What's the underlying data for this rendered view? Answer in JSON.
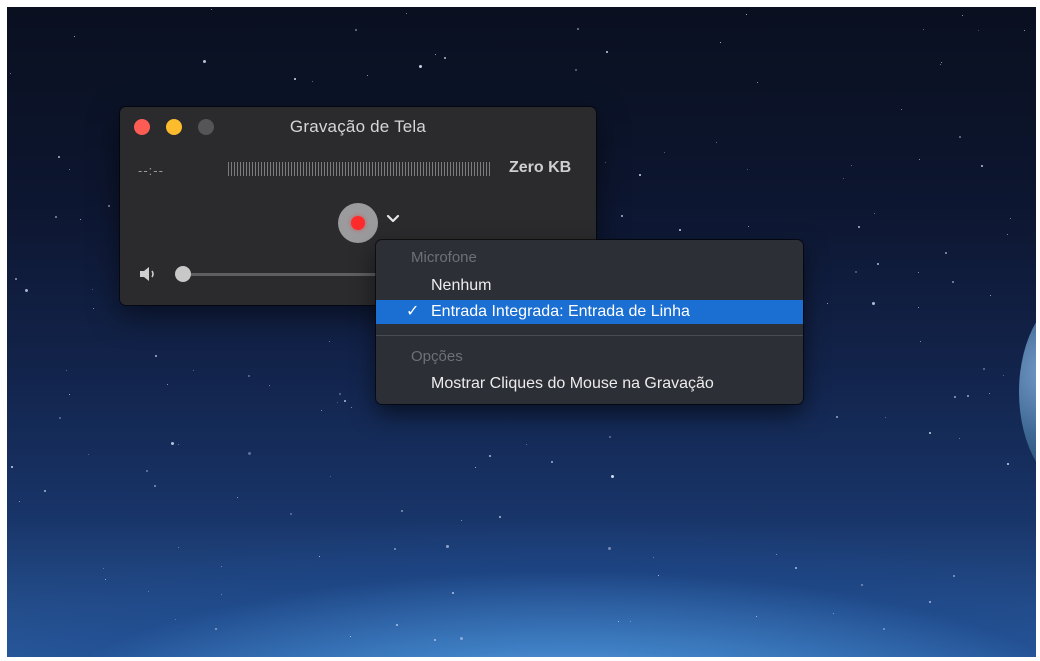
{
  "window": {
    "title": "Gravação de Tela",
    "time": "--:--",
    "file_size": "Zero KB",
    "volume_level": 0
  },
  "menu": {
    "section_microphone": "Microfone",
    "item_none": "Nenhum",
    "item_builtin": "Entrada Integrada: Entrada de Linha",
    "item_builtin_selected": true,
    "checkmark": "✓",
    "section_options": "Opções",
    "item_show_clicks": "Mostrar Cliques do Mouse na Gravação"
  },
  "colors": {
    "close": "#fd5c55",
    "minimize": "#fdbc2d",
    "record": "#ff2a2a",
    "menu_highlight": "#1b6fd2"
  },
  "icons": [
    "close-icon",
    "minimize-icon",
    "zoom-icon",
    "record-icon",
    "chevron-down-icon",
    "speaker-icon",
    "checkmark-icon"
  ]
}
